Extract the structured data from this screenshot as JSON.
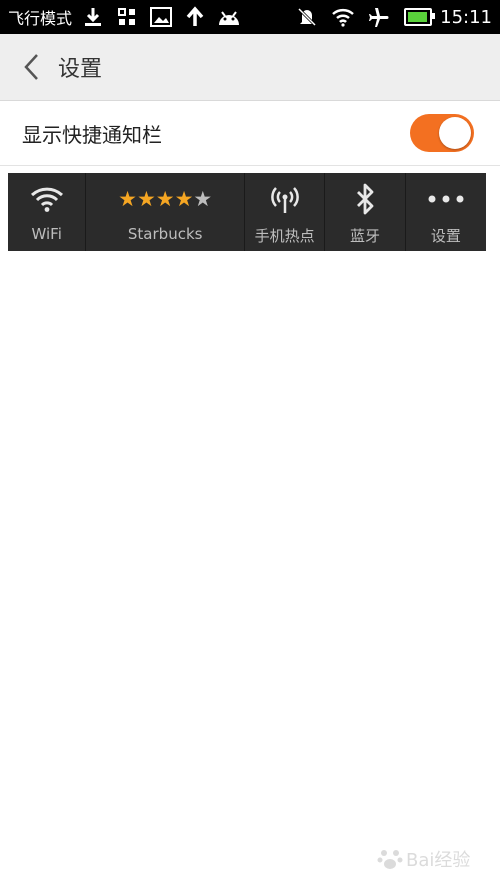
{
  "status_bar": {
    "mode_text": "飞行模式",
    "time": "15:11",
    "battery_level": 0.95,
    "battery_color": "#5ad23b",
    "icons_left": [
      "download-icon",
      "grid-icon",
      "image-icon",
      "upload-icon",
      "android-icon"
    ],
    "icons_right": [
      "vibrate-off-icon",
      "wifi-icon",
      "airplane-icon",
      "battery-icon"
    ]
  },
  "header": {
    "title": "设置"
  },
  "setting": {
    "label": "显示快捷通知栏",
    "toggle_on": true,
    "accent_color": "#f37021"
  },
  "quick_bar": {
    "items": [
      {
        "label": "WiFi",
        "icon": "wifi-icon"
      },
      {
        "label": "Starbucks",
        "icon": "rating-stars",
        "rating": 4,
        "rating_max": 5
      },
      {
        "label": "手机热点",
        "icon": "hotspot-icon"
      },
      {
        "label": "蓝牙",
        "icon": "bluetooth-icon"
      },
      {
        "label": "设置",
        "icon": "more-icon"
      }
    ],
    "star_color": "#f5a623"
  },
  "watermark": {
    "text": "Bai经验"
  }
}
